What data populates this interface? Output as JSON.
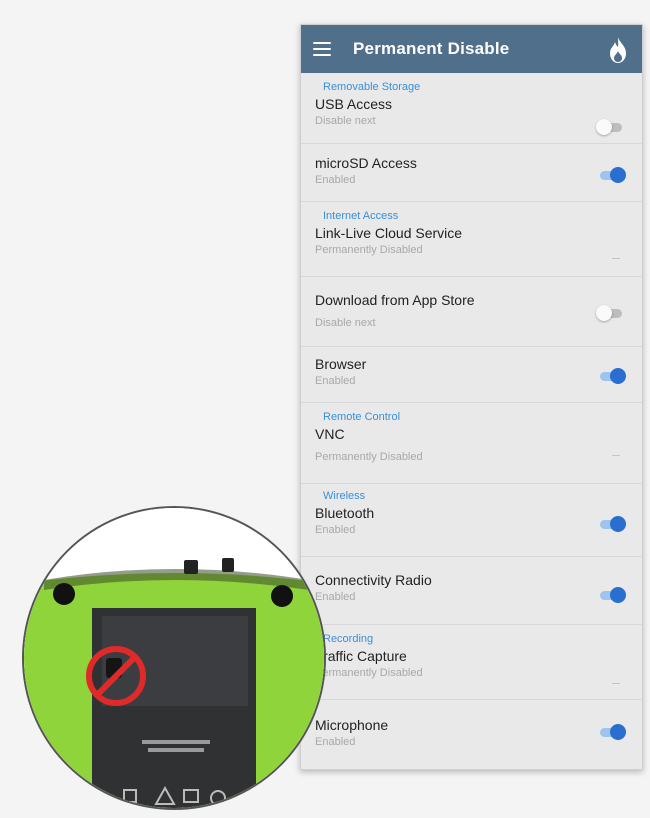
{
  "header": {
    "title": "Permanent Disable"
  },
  "sections": [
    {
      "label": "Removable Storage"
    },
    {
      "label": "Internet Access"
    },
    {
      "label": "Remote Control"
    },
    {
      "label": "Wireless"
    },
    {
      "label": "Recording"
    }
  ],
  "items": [
    {
      "label": "USB Access",
      "status": "Disable next",
      "control": "toggle-off"
    },
    {
      "label": "microSD Access",
      "status": "Enabled",
      "control": "toggle-on"
    },
    {
      "label": "Link-Live Cloud Service",
      "status": "Permanently Disabled",
      "control": "none"
    },
    {
      "label": "Download from App Store",
      "status": "Disable next",
      "control": "toggle-off"
    },
    {
      "label": "Browser",
      "status": "Enabled",
      "control": "toggle-on"
    },
    {
      "label": "VNC",
      "status": "Permanently Disabled",
      "control": "none"
    },
    {
      "label": "Bluetooth",
      "status": "Enabled",
      "control": "toggle-on"
    },
    {
      "label": "Connectivity Radio",
      "status": "Enabled",
      "control": "toggle-on"
    },
    {
      "label": "Traffic Capture",
      "status": "Permanently Disabled",
      "control": "none"
    },
    {
      "label": "Microphone",
      "status": "Enabled",
      "control": "toggle-on"
    }
  ],
  "colors": {
    "appbar": "#4f6f8a",
    "section_header": "#3a8fd6",
    "toggle_on": "#2a6fd0",
    "device_green": "#8fd43a",
    "prohibit_red": "#e02a2a"
  },
  "icons": [
    "menu-icon",
    "flame-icon",
    "prohibited-icon",
    "warning-icon"
  ]
}
